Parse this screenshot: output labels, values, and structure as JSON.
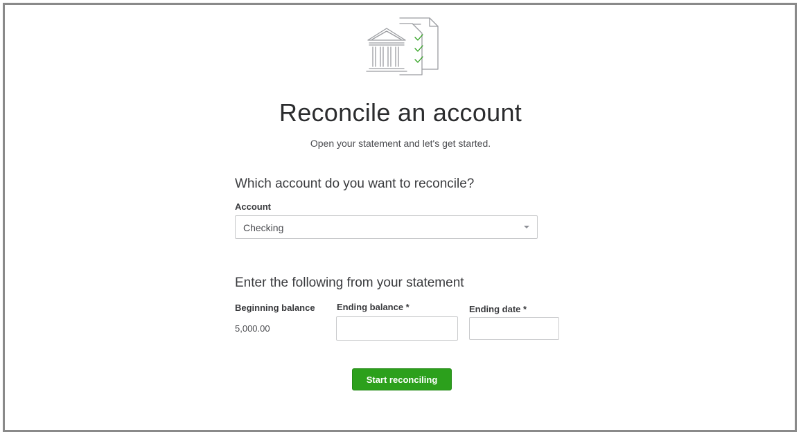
{
  "header": {
    "icon": "bank-statement-checklist-icon",
    "title": "Reconcile an account",
    "subtitle": "Open your statement and let's get started."
  },
  "account_section": {
    "heading": "Which account do you want to reconcile?",
    "account_label": "Account",
    "account_value": "Checking"
  },
  "statement_section": {
    "heading": "Enter the following from your statement",
    "beginning_balance_label": "Beginning balance",
    "beginning_balance_value": "5,000.00",
    "ending_balance_label": "Ending balance *",
    "ending_balance_value": "",
    "ending_date_label": "Ending date *",
    "ending_date_value": ""
  },
  "actions": {
    "start_label": "Start reconciling"
  },
  "colors": {
    "primary_button": "#2ca01c",
    "checkmark": "#2ca01c",
    "icon_stroke": "#9a9ca0",
    "frame_border": "#8a8a8a"
  }
}
